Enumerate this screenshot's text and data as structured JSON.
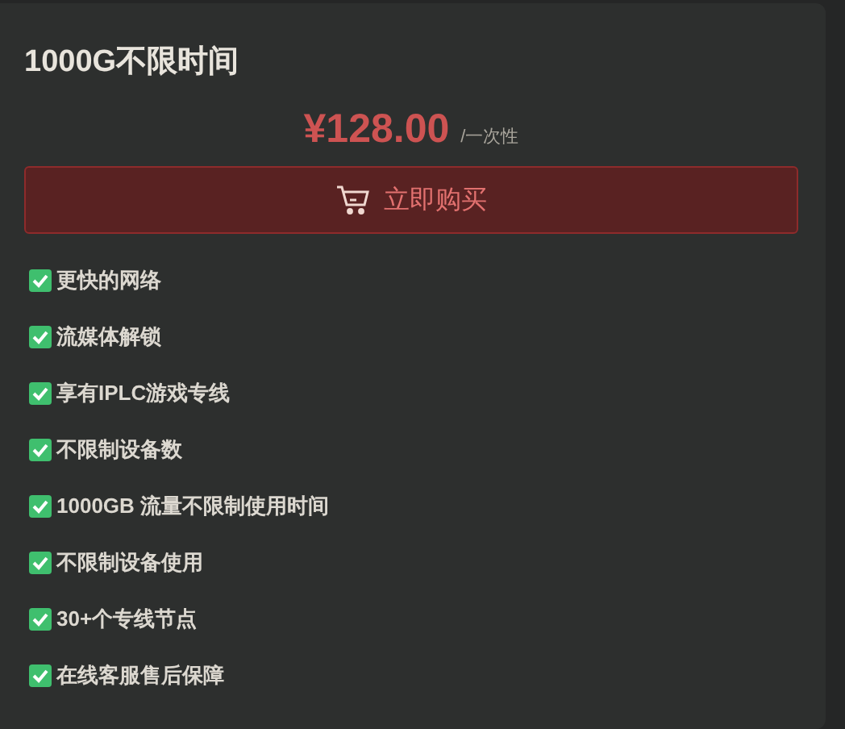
{
  "plan": {
    "title": "1000G不限时间",
    "price": "¥128.00",
    "period": "/一次性",
    "buy_button": "立即购买"
  },
  "features": [
    {
      "label": "更快的网络"
    },
    {
      "label": "流媒体解锁"
    },
    {
      "label": "享有IPLC游戏专线"
    },
    {
      "label": "不限制设备数"
    },
    {
      "label": "1000GB 流量不限制使用时间"
    },
    {
      "label": "不限制设备使用"
    },
    {
      "label": "30+个专线节点"
    },
    {
      "label": "在线客服售后保障"
    }
  ]
}
